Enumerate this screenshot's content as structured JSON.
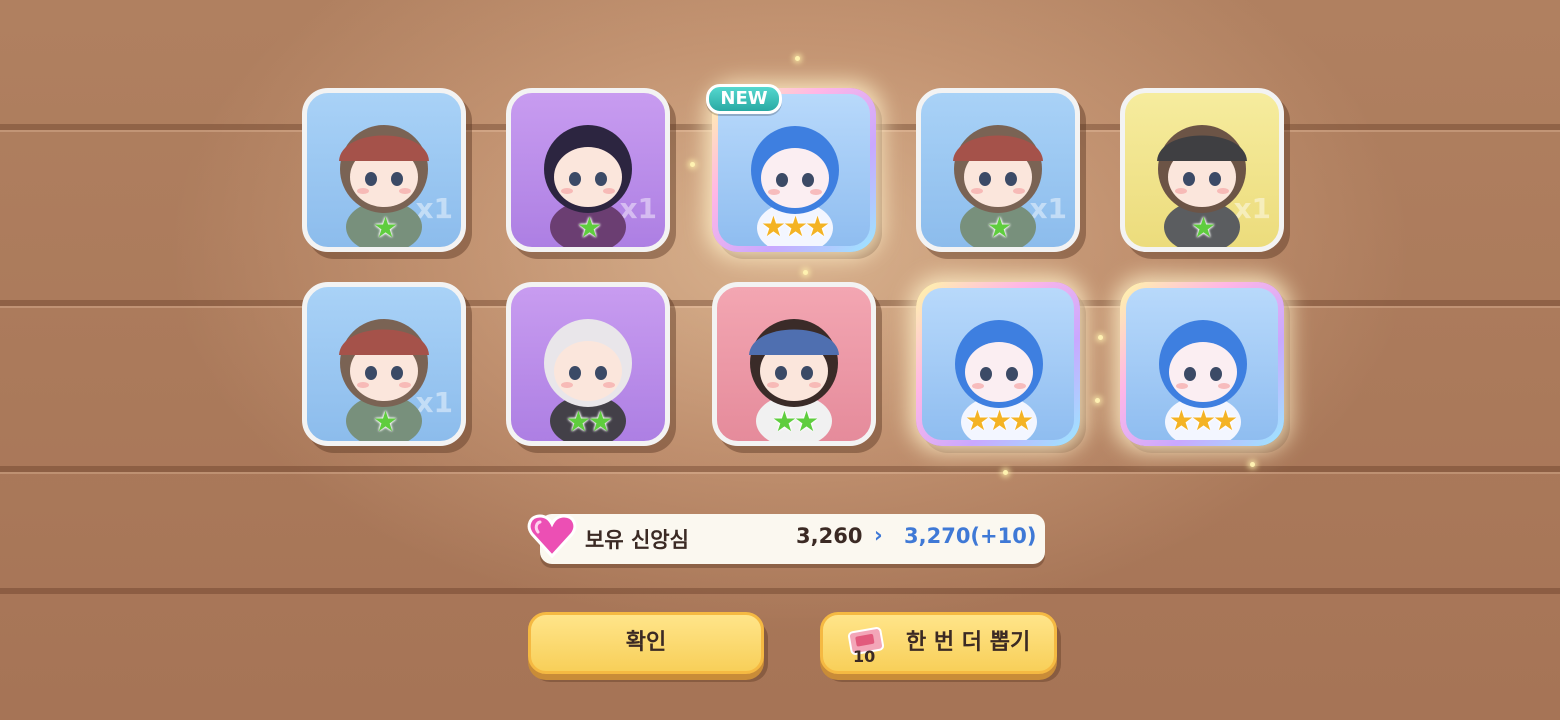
{
  "cards": [
    {
      "bg": "blue",
      "stars": 1,
      "star_color": "green",
      "character": "helmet-soldier",
      "ghost": "x1"
    },
    {
      "bg": "purple",
      "stars": 1,
      "star_color": "green",
      "character": "dark-hair-girl",
      "ghost": "x1"
    },
    {
      "bg": "blue",
      "stars": 3,
      "star_color": "gold",
      "character": "blue-hair-angel",
      "rare": true,
      "new": true
    },
    {
      "bg": "blue",
      "stars": 1,
      "star_color": "green",
      "character": "helmet-soldier",
      "ghost": "x1"
    },
    {
      "bg": "yellow",
      "stars": 1,
      "star_color": "green",
      "character": "visor-soldier",
      "ghost": "x1"
    },
    {
      "bg": "blue",
      "stars": 1,
      "star_color": "green",
      "character": "helmet-soldier",
      "ghost": "x1"
    },
    {
      "bg": "purple",
      "stars": 2,
      "star_color": "green",
      "character": "white-hair-girl"
    },
    {
      "bg": "pink",
      "stars": 2,
      "star_color": "green",
      "character": "beret-girl"
    },
    {
      "bg": "blue",
      "stars": 3,
      "star_color": "gold",
      "character": "blue-hair-angel",
      "rare": true
    },
    {
      "bg": "blue",
      "stars": 3,
      "star_color": "gold",
      "character": "blue-hair-angel",
      "rare": true
    }
  ],
  "new_badge": "NEW",
  "faith": {
    "label": "보유 신앙심",
    "current": "3,260",
    "arrow": "›",
    "after": "3,270(+10)",
    "icon": "heart-gem-icon"
  },
  "buttons": {
    "confirm": "확인",
    "draw_again": "한 번 더 뽑기",
    "ticket_count": "10",
    "ticket_icon": "ticket-icon"
  },
  "colors": {
    "rank_low_star": "#5fcd3e",
    "rank_high_star": "#f4b324",
    "faith_after": "#3f79d6",
    "button": "#f8cf59"
  }
}
